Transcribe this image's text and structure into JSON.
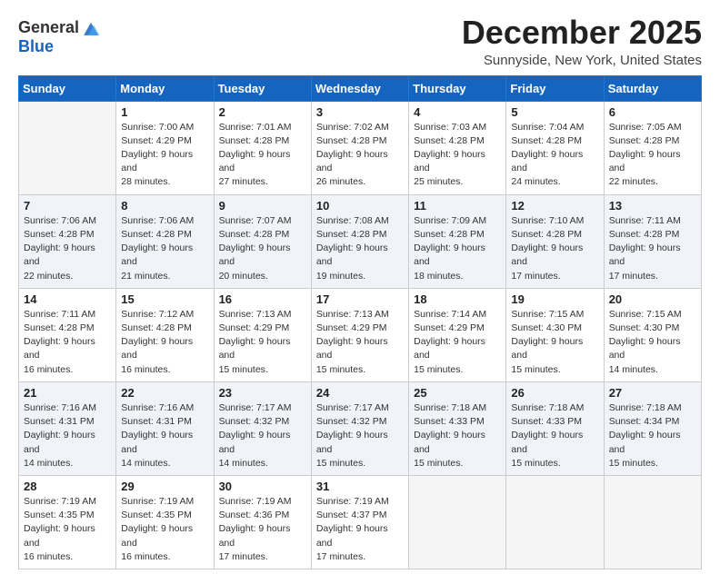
{
  "header": {
    "logo_general": "General",
    "logo_blue": "Blue",
    "title": "December 2025",
    "subtitle": "Sunnyside, New York, United States"
  },
  "days_of_week": [
    "Sunday",
    "Monday",
    "Tuesday",
    "Wednesday",
    "Thursday",
    "Friday",
    "Saturday"
  ],
  "weeks": [
    [
      {
        "day": "",
        "sunrise": "",
        "sunset": "",
        "daylight": ""
      },
      {
        "day": "1",
        "sunrise": "Sunrise: 7:00 AM",
        "sunset": "Sunset: 4:29 PM",
        "daylight": "Daylight: 9 hours and 28 minutes."
      },
      {
        "day": "2",
        "sunrise": "Sunrise: 7:01 AM",
        "sunset": "Sunset: 4:28 PM",
        "daylight": "Daylight: 9 hours and 27 minutes."
      },
      {
        "day": "3",
        "sunrise": "Sunrise: 7:02 AM",
        "sunset": "Sunset: 4:28 PM",
        "daylight": "Daylight: 9 hours and 26 minutes."
      },
      {
        "day": "4",
        "sunrise": "Sunrise: 7:03 AM",
        "sunset": "Sunset: 4:28 PM",
        "daylight": "Daylight: 9 hours and 25 minutes."
      },
      {
        "day": "5",
        "sunrise": "Sunrise: 7:04 AM",
        "sunset": "Sunset: 4:28 PM",
        "daylight": "Daylight: 9 hours and 24 minutes."
      },
      {
        "day": "6",
        "sunrise": "Sunrise: 7:05 AM",
        "sunset": "Sunset: 4:28 PM",
        "daylight": "Daylight: 9 hours and 22 minutes."
      }
    ],
    [
      {
        "day": "7",
        "sunrise": "Sunrise: 7:06 AM",
        "sunset": "Sunset: 4:28 PM",
        "daylight": "Daylight: 9 hours and 22 minutes."
      },
      {
        "day": "8",
        "sunrise": "Sunrise: 7:06 AM",
        "sunset": "Sunset: 4:28 PM",
        "daylight": "Daylight: 9 hours and 21 minutes."
      },
      {
        "day": "9",
        "sunrise": "Sunrise: 7:07 AM",
        "sunset": "Sunset: 4:28 PM",
        "daylight": "Daylight: 9 hours and 20 minutes."
      },
      {
        "day": "10",
        "sunrise": "Sunrise: 7:08 AM",
        "sunset": "Sunset: 4:28 PM",
        "daylight": "Daylight: 9 hours and 19 minutes."
      },
      {
        "day": "11",
        "sunrise": "Sunrise: 7:09 AM",
        "sunset": "Sunset: 4:28 PM",
        "daylight": "Daylight: 9 hours and 18 minutes."
      },
      {
        "day": "12",
        "sunrise": "Sunrise: 7:10 AM",
        "sunset": "Sunset: 4:28 PM",
        "daylight": "Daylight: 9 hours and 17 minutes."
      },
      {
        "day": "13",
        "sunrise": "Sunrise: 7:11 AM",
        "sunset": "Sunset: 4:28 PM",
        "daylight": "Daylight: 9 hours and 17 minutes."
      }
    ],
    [
      {
        "day": "14",
        "sunrise": "Sunrise: 7:11 AM",
        "sunset": "Sunset: 4:28 PM",
        "daylight": "Daylight: 9 hours and 16 minutes."
      },
      {
        "day": "15",
        "sunrise": "Sunrise: 7:12 AM",
        "sunset": "Sunset: 4:28 PM",
        "daylight": "Daylight: 9 hours and 16 minutes."
      },
      {
        "day": "16",
        "sunrise": "Sunrise: 7:13 AM",
        "sunset": "Sunset: 4:29 PM",
        "daylight": "Daylight: 9 hours and 15 minutes."
      },
      {
        "day": "17",
        "sunrise": "Sunrise: 7:13 AM",
        "sunset": "Sunset: 4:29 PM",
        "daylight": "Daylight: 9 hours and 15 minutes."
      },
      {
        "day": "18",
        "sunrise": "Sunrise: 7:14 AM",
        "sunset": "Sunset: 4:29 PM",
        "daylight": "Daylight: 9 hours and 15 minutes."
      },
      {
        "day": "19",
        "sunrise": "Sunrise: 7:15 AM",
        "sunset": "Sunset: 4:30 PM",
        "daylight": "Daylight: 9 hours and 15 minutes."
      },
      {
        "day": "20",
        "sunrise": "Sunrise: 7:15 AM",
        "sunset": "Sunset: 4:30 PM",
        "daylight": "Daylight: 9 hours and 14 minutes."
      }
    ],
    [
      {
        "day": "21",
        "sunrise": "Sunrise: 7:16 AM",
        "sunset": "Sunset: 4:31 PM",
        "daylight": "Daylight: 9 hours and 14 minutes."
      },
      {
        "day": "22",
        "sunrise": "Sunrise: 7:16 AM",
        "sunset": "Sunset: 4:31 PM",
        "daylight": "Daylight: 9 hours and 14 minutes."
      },
      {
        "day": "23",
        "sunrise": "Sunrise: 7:17 AM",
        "sunset": "Sunset: 4:32 PM",
        "daylight": "Daylight: 9 hours and 14 minutes."
      },
      {
        "day": "24",
        "sunrise": "Sunrise: 7:17 AM",
        "sunset": "Sunset: 4:32 PM",
        "daylight": "Daylight: 9 hours and 15 minutes."
      },
      {
        "day": "25",
        "sunrise": "Sunrise: 7:18 AM",
        "sunset": "Sunset: 4:33 PM",
        "daylight": "Daylight: 9 hours and 15 minutes."
      },
      {
        "day": "26",
        "sunrise": "Sunrise: 7:18 AM",
        "sunset": "Sunset: 4:33 PM",
        "daylight": "Daylight: 9 hours and 15 minutes."
      },
      {
        "day": "27",
        "sunrise": "Sunrise: 7:18 AM",
        "sunset": "Sunset: 4:34 PM",
        "daylight": "Daylight: 9 hours and 15 minutes."
      }
    ],
    [
      {
        "day": "28",
        "sunrise": "Sunrise: 7:19 AM",
        "sunset": "Sunset: 4:35 PM",
        "daylight": "Daylight: 9 hours and 16 minutes."
      },
      {
        "day": "29",
        "sunrise": "Sunrise: 7:19 AM",
        "sunset": "Sunset: 4:35 PM",
        "daylight": "Daylight: 9 hours and 16 minutes."
      },
      {
        "day": "30",
        "sunrise": "Sunrise: 7:19 AM",
        "sunset": "Sunset: 4:36 PM",
        "daylight": "Daylight: 9 hours and 17 minutes."
      },
      {
        "day": "31",
        "sunrise": "Sunrise: 7:19 AM",
        "sunset": "Sunset: 4:37 PM",
        "daylight": "Daylight: 9 hours and 17 minutes."
      },
      {
        "day": "",
        "sunrise": "",
        "sunset": "",
        "daylight": ""
      },
      {
        "day": "",
        "sunrise": "",
        "sunset": "",
        "daylight": ""
      },
      {
        "day": "",
        "sunrise": "",
        "sunset": "",
        "daylight": ""
      }
    ]
  ]
}
